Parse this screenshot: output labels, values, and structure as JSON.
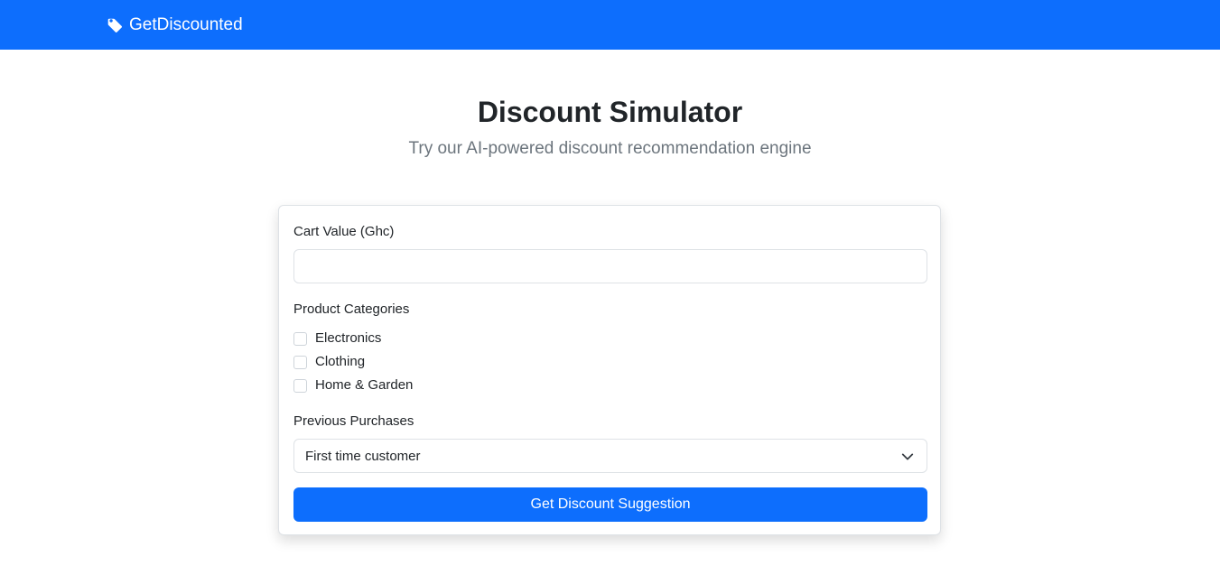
{
  "navbar": {
    "brand": "GetDiscounted",
    "brand_icon": "tag-icon",
    "color": "#0d6efd"
  },
  "hero": {
    "title": "Discount Simulator",
    "subtitle": "Try our AI-powered discount recommendation engine"
  },
  "form": {
    "cart_value": {
      "label": "Cart Value (Ghc)",
      "value": "",
      "placeholder": ""
    },
    "categories": {
      "label": "Product Categories",
      "options": [
        {
          "label": "Electronics",
          "checked": false
        },
        {
          "label": "Clothing",
          "checked": false
        },
        {
          "label": "Home & Garden",
          "checked": false
        }
      ]
    },
    "previous_purchases": {
      "label": "Previous Purchases",
      "selected": "First time customer",
      "icon": "chevron-down-icon"
    },
    "submit_label": "Get Discount Suggestion"
  }
}
